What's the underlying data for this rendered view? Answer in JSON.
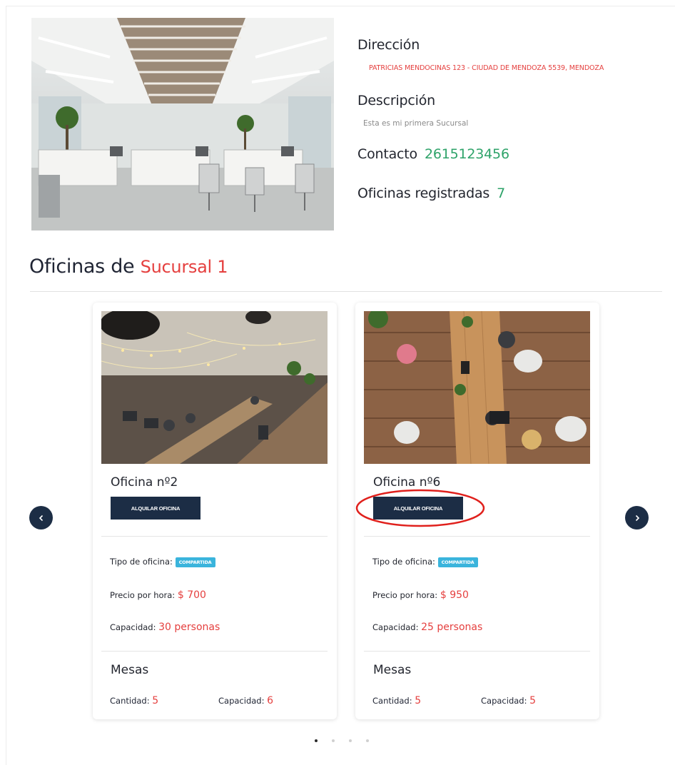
{
  "branch": {
    "direccion_label": "Dirección",
    "direccion_value": "PATRICIAS MENDOCINAS 123 - CIUDAD DE MENDOZA 5539, MENDOZA",
    "descripcion_label": "Descripción",
    "descripcion_value": "Esta es mi primera Sucursal",
    "contacto_label": "Contacto",
    "contacto_value": "2615123456",
    "oficinas_label": "Oficinas registradas",
    "oficinas_value": "7"
  },
  "section": {
    "title_prefix": "Oficinas de",
    "title_branch": "Sucursal 1"
  },
  "offices": [
    {
      "name": "Oficina nº2",
      "button": "ALQUILAR OFICINA",
      "tipo_label": "Tipo de oficina:",
      "tipo_value": "COMPARTIDA",
      "precio_label": "Precio por hora:",
      "precio_value": "$ 700",
      "capacidad_label": "Capacidad:",
      "capacidad_value": "30 personas",
      "mesas_title": "Mesas",
      "cantidad_label": "Cantidad:",
      "cantidad_value": "5",
      "mesa_cap_label": "Capacidad:",
      "mesa_cap_value": "6"
    },
    {
      "name": "Oficina nº6",
      "button": "ALQUILAR OFICINA",
      "tipo_label": "Tipo de oficina:",
      "tipo_value": "COMPARTIDA",
      "precio_label": "Precio por hora:",
      "precio_value": "$ 950",
      "capacidad_label": "Capacidad:",
      "capacidad_value": "25 personas",
      "mesas_title": "Mesas",
      "cantidad_label": "Cantidad:",
      "cantidad_value": "5",
      "mesa_cap_label": "Capacidad:",
      "mesa_cap_value": "5"
    }
  ],
  "carousel": {
    "prev_icon": "chevron-left-icon",
    "next_icon": "chevron-right-icon",
    "pages": 4,
    "active_page": 1
  },
  "colors": {
    "accent_red": "#e5403f",
    "accent_green": "#2fa36a",
    "navy": "#1c2d45",
    "badge_blue": "#3ab4dc",
    "annotation_red": "#e0201c"
  }
}
